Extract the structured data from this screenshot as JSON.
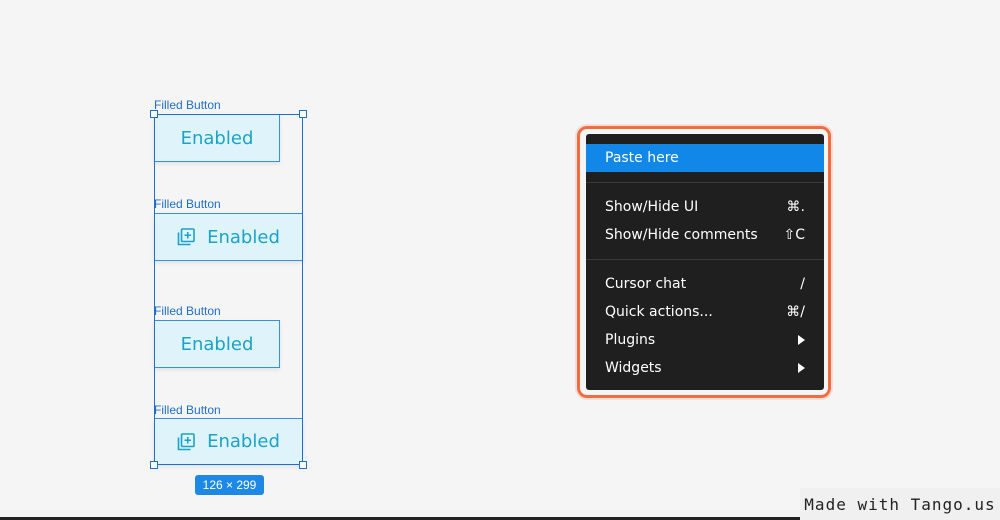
{
  "components": [
    {
      "label": "Filled Button",
      "text": "Enabled",
      "has_icon": false,
      "icon": ""
    },
    {
      "label": "Filled Button",
      "text": "Enabled",
      "has_icon": true,
      "icon": "library-add-icon"
    },
    {
      "label": "Filled Button",
      "text": "Enabled",
      "has_icon": false,
      "icon": ""
    },
    {
      "label": "Filled Button",
      "text": "Enabled",
      "has_icon": true,
      "icon": "library-add-icon"
    }
  ],
  "selection": {
    "dimensions": "126 × 299"
  },
  "context_menu": {
    "items": [
      {
        "label": "Paste here",
        "shortcut": "",
        "active": true
      },
      {
        "label": "Show/Hide UI",
        "shortcut": "⌘."
      },
      {
        "label": "Show/Hide comments",
        "shortcut": "⇧C"
      },
      {
        "label": "Cursor chat",
        "shortcut": "/"
      },
      {
        "label": "Quick actions...",
        "shortcut": "⌘/"
      },
      {
        "label": "Plugins",
        "submenu": true
      },
      {
        "label": "Widgets",
        "submenu": true
      }
    ]
  },
  "watermark": "Made with Tango.us",
  "colors": {
    "selection": "#1e6fc9",
    "button_bg": "#dff3fa",
    "button_text": "#1aa3c8",
    "menu_bg": "#1f1f1f",
    "menu_active": "#1188e8",
    "highlight": "#f36c3f"
  }
}
